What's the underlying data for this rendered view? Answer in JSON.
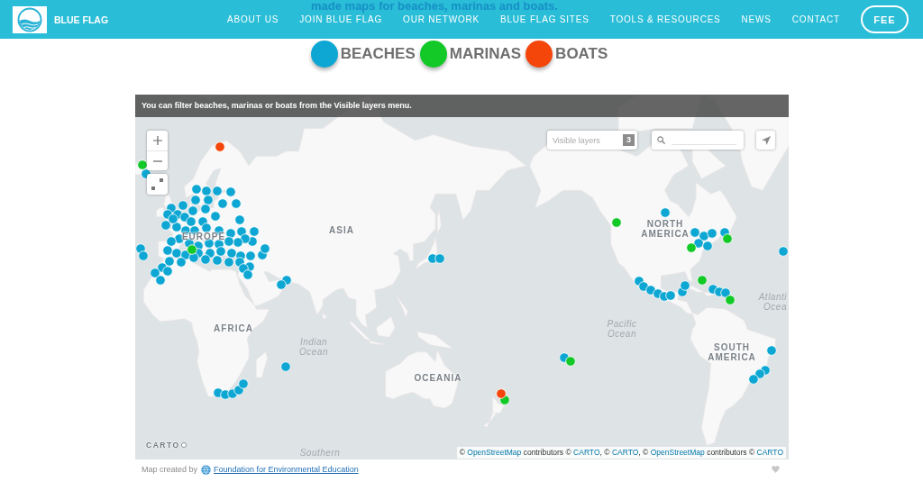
{
  "page_heading": "made maps for beaches, marinas and boats.",
  "header": {
    "brand": "BLUE FLAG",
    "nav": [
      "ABOUT US",
      "JOIN BLUE FLAG",
      "OUR NETWORK",
      "BLUE FLAG SITES",
      "TOOLS & RESOURCES",
      "NEWS",
      "CONTACT"
    ],
    "button": "FEE"
  },
  "legend": [
    {
      "label": "BEACHES",
      "color": "#0ea7d3"
    },
    {
      "label": "MARINAS",
      "color": "#12c928"
    },
    {
      "label": "BOATS",
      "color": "#f4460b"
    }
  ],
  "map": {
    "banner": "You can filter beaches, marinas or boats from the Visible layers menu.",
    "layers_select": {
      "placeholder": "Visible layers",
      "count": "3"
    },
    "labels": [
      {
        "kind": "continent",
        "lines": [
          "EUROPE"
        ]
      },
      {
        "kind": "continent",
        "lines": [
          "ASIA"
        ]
      },
      {
        "kind": "continent",
        "lines": [
          "NORTH",
          "AMERICA"
        ]
      },
      {
        "kind": "ocean",
        "lines": [
          "Atlanti",
          "Ocea"
        ]
      },
      {
        "kind": "continent",
        "lines": [
          "AFRICA"
        ]
      },
      {
        "kind": "ocean",
        "lines": [
          "Pacific",
          "Ocean"
        ]
      },
      {
        "kind": "ocean",
        "lines": [
          "Indian",
          "Ocean"
        ]
      },
      {
        "kind": "continent",
        "lines": [
          "SOUTH",
          "AMERICA"
        ]
      },
      {
        "kind": "continent",
        "lines": [
          "OCEANIA"
        ]
      },
      {
        "kind": "ocean",
        "lines": [
          "Southern"
        ]
      }
    ],
    "logo": "CARTO",
    "attribution": [
      {
        "kind": "text",
        "text": "©"
      },
      {
        "kind": "link",
        "text": "OpenStreetMap"
      },
      {
        "kind": "text",
        "text": "contributors ©"
      },
      {
        "kind": "link",
        "text": "CARTO"
      },
      {
        "kind": "text",
        "text": ", ©"
      },
      {
        "kind": "link",
        "text": "CARTO"
      },
      {
        "kind": "text",
        "text": ", ©"
      },
      {
        "kind": "link",
        "text": "OpenStreetMap"
      },
      {
        "kind": "text",
        "text": "contributors ©"
      },
      {
        "kind": "link",
        "text": "CARTO"
      }
    ]
  },
  "footer": {
    "credit": "Map created by",
    "link": "Foundation for Environmental Education"
  }
}
